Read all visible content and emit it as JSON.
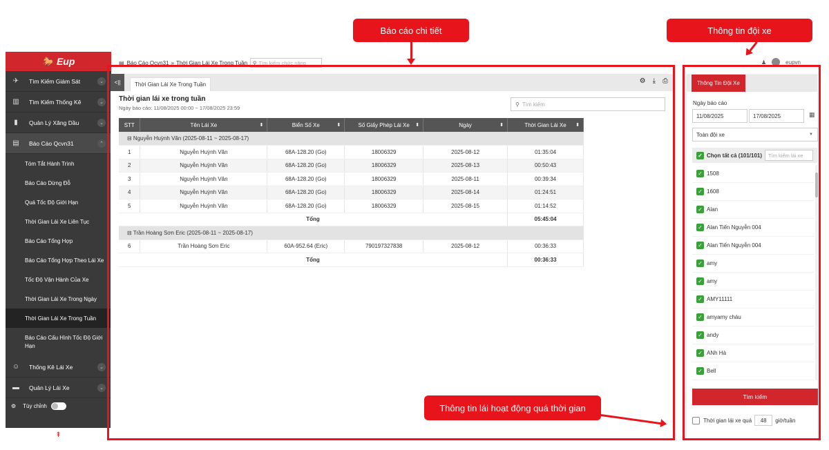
{
  "app": {
    "logo": "Eup"
  },
  "sidebar": {
    "items": [
      {
        "label": "Tìm Kiếm Giám Sát",
        "icon": "satellite-icon"
      },
      {
        "label": "Tìm Kiếm Thống Kê",
        "icon": "bar-chart-icon"
      },
      {
        "label": "Quản Lý Xăng Dầu",
        "icon": "fuel-icon"
      },
      {
        "label": "Báo Cáo Qcvn31",
        "icon": "report-icon"
      }
    ],
    "subitems": [
      {
        "label": "Tóm Tắt Hành Trình"
      },
      {
        "label": "Báo Cáo Dừng Đỗ"
      },
      {
        "label": "Quá Tốc Độ Giới Hạn"
      },
      {
        "label": "Thời Gian Lái Xe Liên Tục"
      },
      {
        "label": "Báo Cáo Tổng Hợp"
      },
      {
        "label": "Báo Cáo Tổng Hợp Theo Lái Xe"
      },
      {
        "label": "Tốc Độ Vận Hành Của Xe"
      },
      {
        "label": "Thời Gian Lái Xe Trong Ngày"
      },
      {
        "label": "Thời Gian Lái Xe Trong Tuần"
      },
      {
        "label": "Báo Cáo Cấu Hình Tốc Độ Giới Hạn"
      }
    ],
    "bottom_items": [
      {
        "label": "Thống Kê Lái Xe",
        "icon": "driver-stats-icon"
      },
      {
        "label": "Quản Lý Lái Xe",
        "icon": "briefcase-icon"
      }
    ],
    "toggle_label": "Tùy chỉnh"
  },
  "header": {
    "breadcrumb_1": "Báo Cáo Qcvn31",
    "breadcrumb_sep": "»",
    "breadcrumb_2": "Thời Gian Lái Xe Trong Tuần",
    "search_placeholder": "Tìm kiếm chức năng",
    "username": "eupvn"
  },
  "main": {
    "collapse_label": "<||",
    "tab_label": "Thời Gian Lái Xe Trong Tuần",
    "title": "Thời gian lái xe trong tuần",
    "date_range": "Ngày báo cáo: 11/08/2025 00:00 ~ 17/08/2025 23:59",
    "search_placeholder": "Tìm kiếm",
    "columns": [
      "STT",
      "Tên Lái Xe",
      "Biển Số Xe",
      "Số Giấy Phép Lái Xe",
      "Ngày",
      "Thời Gian Lái Xe"
    ],
    "groups": [
      {
        "title": "⊟ Nguyễn Huỳnh Văn (2025-08-11 ~ 2025-08-17)",
        "rows": [
          [
            "1",
            "Nguyễn Huỳnh Văn",
            "68A-128.20 (Go)",
            "18006329",
            "2025-08-12",
            "01:35:04"
          ],
          [
            "2",
            "Nguyễn Huỳnh Văn",
            "68A-128.20 (Go)",
            "18006329",
            "2025-08-13",
            "00:50:43"
          ],
          [
            "3",
            "Nguyễn Huỳnh Văn",
            "68A-128.20 (Go)",
            "18006329",
            "2025-08-11",
            "00:39:34"
          ],
          [
            "4",
            "Nguyễn Huỳnh Văn",
            "68A-128.20 (Go)",
            "18006329",
            "2025-08-14",
            "01:24:51"
          ],
          [
            "5",
            "Nguyễn Huỳnh Văn",
            "68A-128.20 (Go)",
            "18006329",
            "2025-08-15",
            "01:14:52"
          ]
        ],
        "total_label": "Tổng",
        "total": "05:45:04"
      },
      {
        "title": "⊟ Trần Hoàng Sơn Eric (2025-08-11 ~ 2025-08-17)",
        "rows": [
          [
            "6",
            "Trần Hoàng Sơn Eric",
            "60A-952.64 (Eric)",
            "790197327838",
            "2025-08-12",
            "00:36:33"
          ]
        ],
        "total_label": "Tổng",
        "total": "00:36:33"
      }
    ]
  },
  "right_panel": {
    "tab_label": "Thông Tin Đội Xe",
    "date_label": "Ngày báo cáo",
    "date_from": "11/08/2025",
    "date_to": "17/08/2025",
    "fleet_value": "Toàn đội xe",
    "select_all": "Chọn tất cả (101/101)",
    "driver_search_placeholder": "Tìm kiếm lái xe",
    "drivers": [
      "1508",
      "1608",
      "Alan",
      "Alan Tiến Nguyễn 004",
      "Alan Tiến Nguyễn 004",
      "amy",
      "amy",
      "AMY11111",
      "amyamy cháu",
      "andy",
      "ANh Hà",
      "Bell"
    ],
    "search_button": "Tìm kiếm",
    "threshold_label": "Thời gian lái xe quá",
    "threshold_value": "48",
    "threshold_unit": "giờ/tuần"
  },
  "annotations": {
    "detail_report": "Báo cáo chi tiết",
    "fleet_info": "Thông tin đội xe",
    "overtime_info": "Thông tin lái hoạt động quá thời gian"
  },
  "colors": {
    "accent": "#d0262c",
    "annotation": "#e8141b",
    "sidebar": "#3a3a3a",
    "check": "#3aa13a"
  }
}
